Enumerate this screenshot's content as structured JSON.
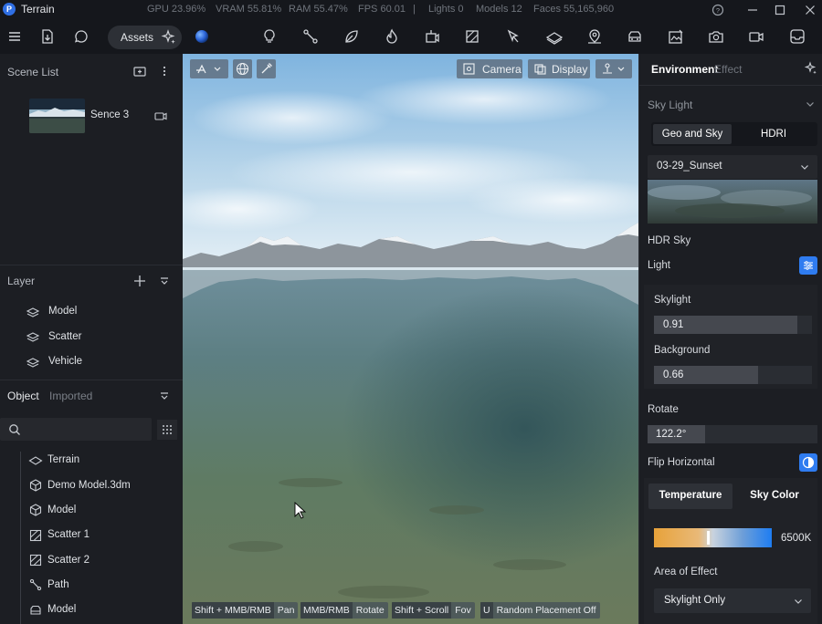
{
  "app": {
    "title": "Terrain",
    "logo_letter": "P"
  },
  "stats": {
    "gpu": "GPU 23.96%",
    "vram": "VRAM 55.81%",
    "ram": "RAM 55.47%",
    "fps": "FPS 60.01",
    "separator": "|",
    "lights": "Lights 0",
    "models": "Models 12",
    "faces": "Faces 55,165,960"
  },
  "toolbar": {
    "assets_label": "Assets"
  },
  "scene_list": {
    "title": "Scene List",
    "items": [
      {
        "label": "Sence 3"
      }
    ]
  },
  "layer": {
    "title": "Layer",
    "items": [
      {
        "label": "Model"
      },
      {
        "label": "Scatter"
      },
      {
        "label": "Vehicle"
      }
    ]
  },
  "object": {
    "tabs": [
      {
        "label": "Object"
      },
      {
        "label": "Imported"
      }
    ],
    "items": [
      {
        "label": "Terrain",
        "icon": "terrain-icon"
      },
      {
        "label": "Demo Model.3dm",
        "icon": "cube-icon"
      },
      {
        "label": "Model",
        "icon": "cube-icon"
      },
      {
        "label": "Scatter 1",
        "icon": "scatter-icon"
      },
      {
        "label": "Scatter 2",
        "icon": "scatter-icon"
      },
      {
        "label": "Path",
        "icon": "path-icon"
      },
      {
        "label": "Model",
        "icon": "vehicle-icon"
      }
    ]
  },
  "viewport": {
    "camera_label": "Camera",
    "display_label": "Display",
    "hints": [
      {
        "key": "Shift + MMB/RMB",
        "action": "Pan"
      },
      {
        "key": "MMB/RMB",
        "action": "Rotate"
      },
      {
        "key": "Shift + Scroll",
        "action": "Fov"
      },
      {
        "key": "U",
        "action": "Random Placement Off"
      }
    ]
  },
  "right_panel": {
    "tabs": [
      {
        "label": "Environment"
      },
      {
        "label": "Effect"
      }
    ],
    "sky_light": {
      "title": "Sky Light",
      "mode_tabs": [
        {
          "label": "Geo and Sky"
        },
        {
          "label": "HDRI"
        }
      ],
      "selected_hdri": "03-29_Sunset",
      "hdr_sky_label": "HDR Sky",
      "light_label": "Light",
      "skylight": {
        "label": "Skylight",
        "value": "0.91",
        "fraction": 0.91
      },
      "background": {
        "label": "Background",
        "value": "0.66",
        "fraction": 0.66
      },
      "rotate": {
        "label": "Rotate",
        "value": "122.2°",
        "fraction": 0.34
      },
      "flip_label": "Flip Horizontal",
      "color_tabs": [
        {
          "label": "Temperature"
        },
        {
          "label": "Sky Color"
        }
      ],
      "temperature_value": "6500K",
      "temperature_fraction": 0.45,
      "area_label": "Area of Effect",
      "area_value": "Skylight Only"
    },
    "colors": {
      "accent": "#2f7cf0",
      "warm": "#e7a23a",
      "cool": "#1e7df2"
    }
  }
}
